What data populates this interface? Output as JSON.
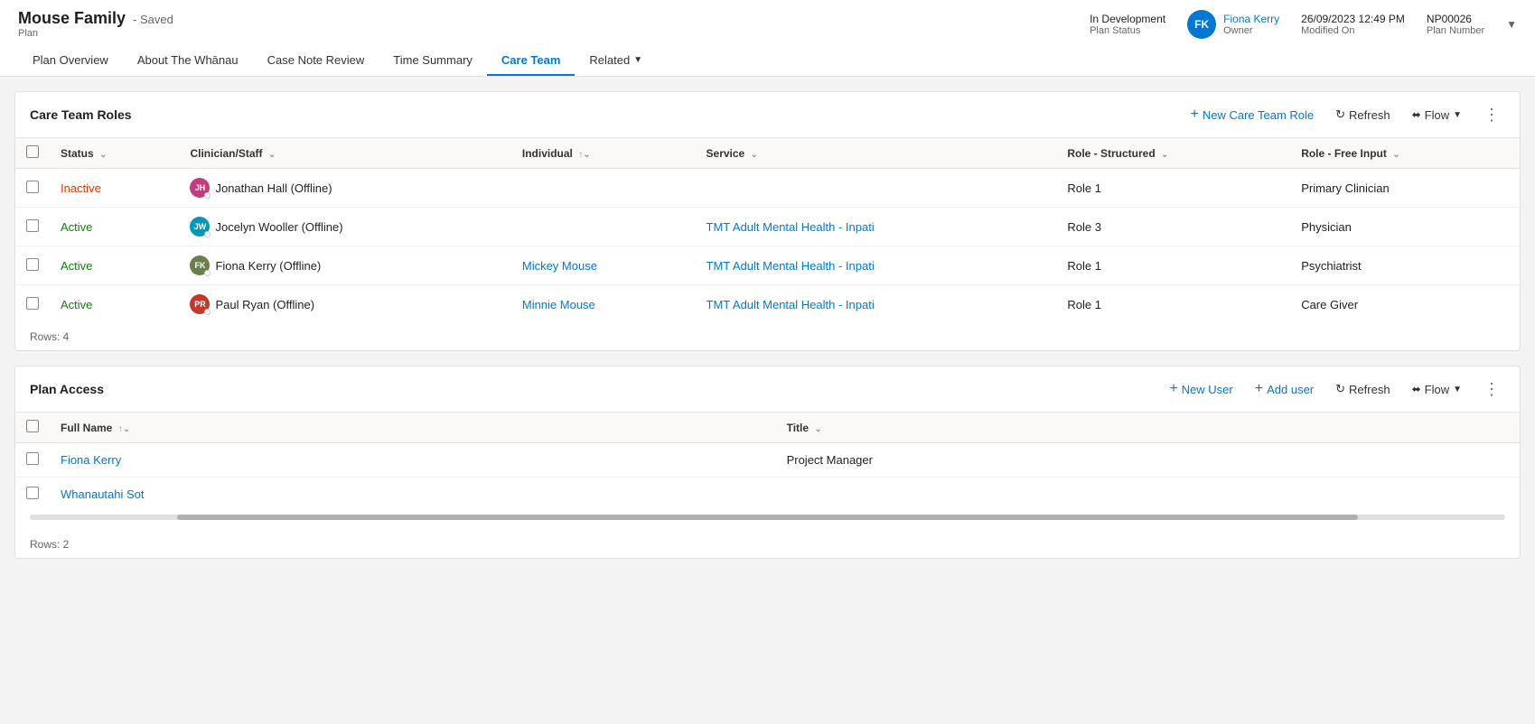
{
  "header": {
    "title": "Mouse Family",
    "saved_label": "- Saved",
    "subtitle": "Plan",
    "status_label": "Plan Status",
    "status_value": "In Development",
    "owner_label": "Owner",
    "owner_name": "Fiona Kerry",
    "owner_initials": "FK",
    "modified_label": "Modified On",
    "modified_date": "26/09/2023 12:49 PM",
    "plan_number_label": "Plan Number",
    "plan_number": "NP00026"
  },
  "nav": {
    "tabs": [
      {
        "id": "plan-overview",
        "label": "Plan Overview",
        "active": false
      },
      {
        "id": "about-whanau",
        "label": "About The Whānau",
        "active": false
      },
      {
        "id": "case-note-review",
        "label": "Case Note Review",
        "active": false
      },
      {
        "id": "time-summary",
        "label": "Time Summary",
        "active": false
      },
      {
        "id": "care-team",
        "label": "Care Team",
        "active": true
      },
      {
        "id": "related",
        "label": "Related",
        "active": false,
        "has_arrow": true
      }
    ]
  },
  "care_team_roles": {
    "section_title": "Care Team Roles",
    "actions": {
      "new_label": "New Care Team Role",
      "refresh_label": "Refresh",
      "flow_label": "Flow"
    },
    "columns": [
      {
        "id": "status",
        "label": "Status",
        "sortable": true
      },
      {
        "id": "clinician",
        "label": "Clinician/Staff",
        "sortable": true
      },
      {
        "id": "individual",
        "label": "Individual",
        "sortable": true,
        "sort_dir": "asc"
      },
      {
        "id": "service",
        "label": "Service",
        "sortable": true
      },
      {
        "id": "role_structured",
        "label": "Role - Structured",
        "sortable": true
      },
      {
        "id": "role_free",
        "label": "Role - Free Input",
        "sortable": true
      }
    ],
    "rows": [
      {
        "id": "row1",
        "status": "Inactive",
        "clinician_name": "Jonathan Hall (Offline)",
        "clinician_initials": "JH",
        "clinician_color": "#c43d7a",
        "individual": "",
        "service": "",
        "role_structured": "Role 1",
        "role_free": "Primary Clinician"
      },
      {
        "id": "row2",
        "status": "Active",
        "clinician_name": "Jocelyn Wooller (Offline)",
        "clinician_initials": "JW",
        "clinician_color": "#0099b8",
        "individual": "",
        "service": "TMT Adult Mental Health - Inpati",
        "role_structured": "Role 3",
        "role_free": "Physician"
      },
      {
        "id": "row3",
        "status": "Active",
        "clinician_name": "Fiona Kerry (Offline)",
        "clinician_initials": "FK",
        "clinician_color": "#6b7f4a",
        "individual": "Mickey Mouse",
        "service": "TMT Adult Mental Health - Inpati",
        "role_structured": "Role 1",
        "role_free": "Psychiatrist"
      },
      {
        "id": "row4",
        "status": "Active",
        "clinician_name": "Paul Ryan (Offline)",
        "clinician_initials": "PR",
        "clinician_color": "#c0392b",
        "individual": "Minnie Mouse",
        "service": "TMT Adult Mental Health - Inpati",
        "role_structured": "Role 1",
        "role_free": "Care Giver"
      }
    ],
    "rows_count": "Rows: 4"
  },
  "plan_access": {
    "section_title": "Plan Access",
    "actions": {
      "new_user_label": "New User",
      "add_user_label": "Add user",
      "refresh_label": "Refresh",
      "flow_label": "Flow"
    },
    "columns": [
      {
        "id": "full_name",
        "label": "Full Name",
        "sortable": true,
        "sort_dir": "asc"
      },
      {
        "id": "title",
        "label": "Title",
        "sortable": true
      }
    ],
    "rows": [
      {
        "id": "pa_row1",
        "full_name": "Fiona Kerry",
        "title": "Project Manager"
      },
      {
        "id": "pa_row2",
        "full_name": "Whanautahi Sot",
        "title": ""
      }
    ],
    "rows_count": "Rows: 2"
  }
}
